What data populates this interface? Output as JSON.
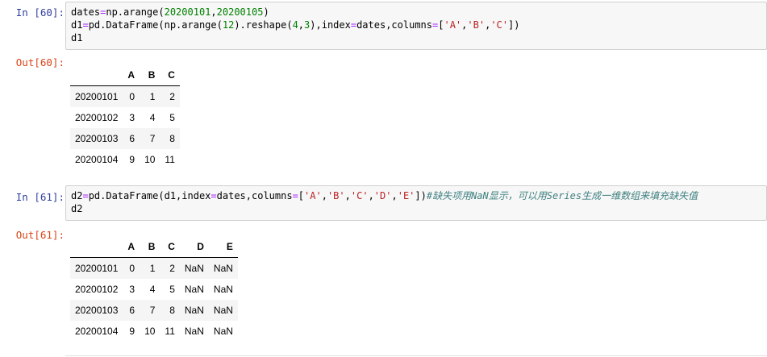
{
  "cells": [
    {
      "in_prompt": "In  [60]:",
      "out_prompt": "Out[60]:",
      "code": [
        [
          {
            "t": "dates"
          },
          {
            "t": "=",
            "c": "tok-op"
          },
          {
            "t": "np.arange("
          },
          {
            "t": "20200101",
            "c": "tok-num"
          },
          {
            "t": ","
          },
          {
            "t": "20200105",
            "c": "tok-num"
          },
          {
            "t": ")"
          }
        ],
        [
          {
            "t": "d1"
          },
          {
            "t": "=",
            "c": "tok-op"
          },
          {
            "t": "pd.DataFrame(np.arange("
          },
          {
            "t": "12",
            "c": "tok-num"
          },
          {
            "t": ").reshape("
          },
          {
            "t": "4",
            "c": "tok-num"
          },
          {
            "t": ","
          },
          {
            "t": "3",
            "c": "tok-num"
          },
          {
            "t": "),index"
          },
          {
            "t": "=",
            "c": "tok-op"
          },
          {
            "t": "dates,columns"
          },
          {
            "t": "=",
            "c": "tok-op"
          },
          {
            "t": "["
          },
          {
            "t": "'A'",
            "c": "tok-str"
          },
          {
            "t": ","
          },
          {
            "t": "'B'",
            "c": "tok-str"
          },
          {
            "t": ","
          },
          {
            "t": "'C'",
            "c": "tok-str"
          },
          {
            "t": "])"
          }
        ],
        [
          {
            "t": "d1"
          }
        ]
      ],
      "table": {
        "columns": [
          "A",
          "B",
          "C"
        ],
        "rows": [
          {
            "index": "20200101",
            "values": [
              "0",
              "1",
              "2"
            ]
          },
          {
            "index": "20200102",
            "values": [
              "3",
              "4",
              "5"
            ]
          },
          {
            "index": "20200103",
            "values": [
              "6",
              "7",
              "8"
            ]
          },
          {
            "index": "20200104",
            "values": [
              "9",
              "10",
              "11"
            ]
          }
        ]
      }
    },
    {
      "in_prompt": "In  [61]:",
      "out_prompt": "Out[61]:",
      "code": [
        [
          {
            "t": "d2"
          },
          {
            "t": "=",
            "c": "tok-op"
          },
          {
            "t": "pd.DataFrame(d1,index"
          },
          {
            "t": "=",
            "c": "tok-op"
          },
          {
            "t": "dates,columns"
          },
          {
            "t": "=",
            "c": "tok-op"
          },
          {
            "t": "["
          },
          {
            "t": "'A'",
            "c": "tok-str"
          },
          {
            "t": ","
          },
          {
            "t": "'B'",
            "c": "tok-str"
          },
          {
            "t": ","
          },
          {
            "t": "'C'",
            "c": "tok-str"
          },
          {
            "t": ","
          },
          {
            "t": "'D'",
            "c": "tok-str"
          },
          {
            "t": ","
          },
          {
            "t": "'E'",
            "c": "tok-str"
          },
          {
            "t": "])"
          },
          {
            "t": "#缺失项用NaN显示，可以用Series生成一维数组来填充缺失值",
            "c": "tok-comment"
          }
        ],
        [
          {
            "t": "d2"
          }
        ]
      ],
      "table": {
        "columns": [
          "A",
          "B",
          "C",
          "D",
          "E"
        ],
        "rows": [
          {
            "index": "20200101",
            "values": [
              "0",
              "1",
              "2",
              "NaN",
              "NaN"
            ]
          },
          {
            "index": "20200102",
            "values": [
              "3",
              "4",
              "5",
              "NaN",
              "NaN"
            ]
          },
          {
            "index": "20200103",
            "values": [
              "6",
              "7",
              "8",
              "NaN",
              "NaN"
            ]
          },
          {
            "index": "20200104",
            "values": [
              "9",
              "10",
              "11",
              "NaN",
              "NaN"
            ]
          }
        ]
      }
    }
  ]
}
